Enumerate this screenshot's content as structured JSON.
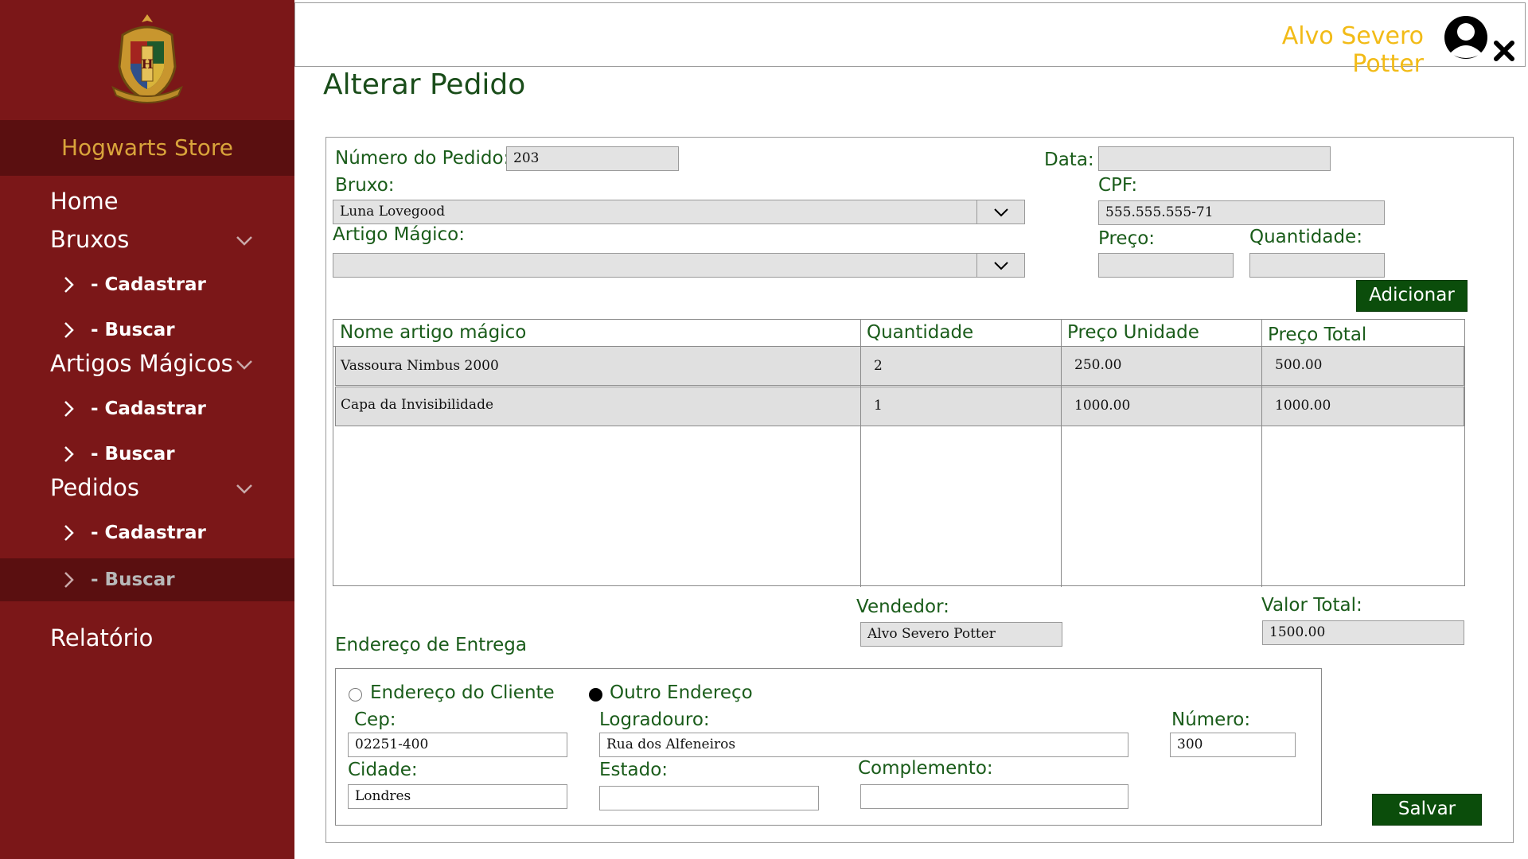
{
  "app": {
    "store_name": "Hogwarts Store",
    "user_name": "Alvo Severo Potter"
  },
  "sidebar": {
    "home": "Home",
    "bruxos": {
      "label": "Bruxos",
      "cadastrar": "- Cadastrar",
      "buscar": "- Buscar"
    },
    "artigos": {
      "label": "Artigos Mágicos",
      "cadastrar": "- Cadastrar",
      "buscar": "- Buscar"
    },
    "pedidos": {
      "label": "Pedidos",
      "cadastrar": "- Cadastrar",
      "buscar": "- Buscar"
    },
    "relatorio": "Relatório",
    "active_item": "pedidos.buscar"
  },
  "page": {
    "title": "Alterar Pedido"
  },
  "form": {
    "numero_label": "Número do Pedido:",
    "numero_value": "203",
    "data_label": "Data:",
    "data_value": "",
    "bruxo_label": "Bruxo:",
    "bruxo_value": "Luna Lovegood",
    "cpf_label": "CPF:",
    "cpf_value": "555.555.555-71",
    "artigo_label": "Artigo Mágico:",
    "artigo_value": "",
    "preco_label": "Preço:",
    "preco_value": "",
    "quantidade_label": "Quantidade:",
    "quantidade_value": "",
    "adicionar_label": "Adicionar"
  },
  "table": {
    "headers": [
      "Nome artigo mágico",
      "Quantidade",
      "Preço Unidade",
      "Preço Total"
    ],
    "rows": [
      [
        "Vassoura Nimbus 2000",
        "2",
        "250.00",
        "500.00"
      ],
      [
        "Capa da Invisibilidade",
        "1",
        "1000.00",
        "1000.00"
      ]
    ]
  },
  "summary": {
    "vendedor_label": "Vendedor:",
    "vendedor_value": "Alvo Severo Potter",
    "valor_total_label": "Valor Total:",
    "valor_total_value": "1500.00"
  },
  "endereco": {
    "section_label": "Endereço de Entrega",
    "radio_cliente": "Endereço do Cliente",
    "radio_outro": "Outro Endereço",
    "selected": "outro",
    "cep_label": "Cep:",
    "cep_value": "02251-400",
    "logradouro_label": "Logradouro:",
    "logradouro_value": "Rua dos Alfeneiros",
    "numero_label": "Número:",
    "numero_value": "300",
    "cidade_label": "Cidade:",
    "cidade_value": "Londres",
    "estado_label": "Estado:",
    "estado_value": "",
    "complemento_label": "Complemento:",
    "complemento_value": ""
  },
  "actions": {
    "salvar_label": "Salvar"
  },
  "icons": {
    "crest": "hogwarts-crest-icon",
    "user": "user-avatar-icon",
    "close": "close-icon",
    "chevron_down": "chevron-down-icon",
    "chevron_right": "chevron-right-icon"
  },
  "colors": {
    "sidebar_bg": "#7b1718",
    "sidebar_dark": "#5a0f10",
    "store_name": "#d9a43b",
    "user_name": "#f2bb17",
    "label_green": "#1a5c1a",
    "button_green": "#0b4d0b"
  }
}
